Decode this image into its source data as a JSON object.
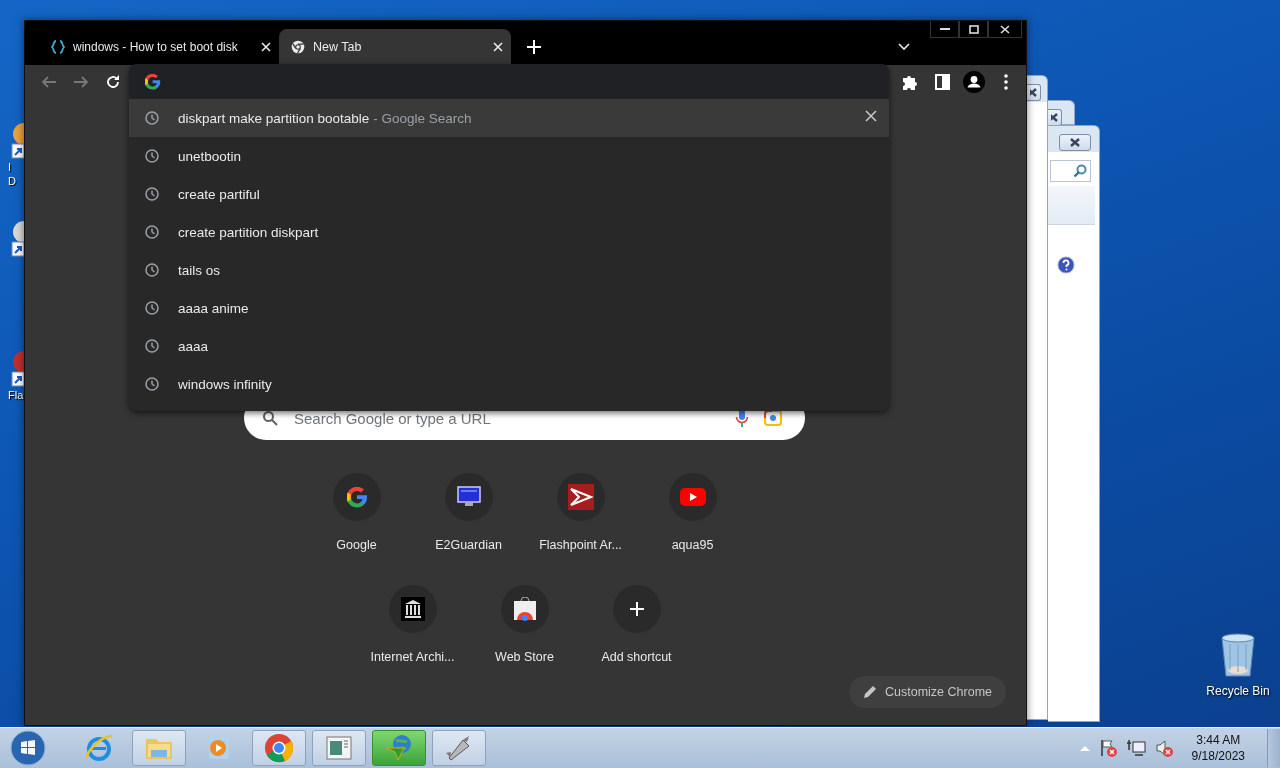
{
  "desktop": {
    "icons": [
      {
        "kind": "wheel",
        "lines": [
          "I",
          "D"
        ]
      },
      {
        "kind": "disc"
      },
      {
        "kind": "red",
        "lines": [
          "Fla"
        ]
      }
    ],
    "recycle_bin": "Recycle Bin"
  },
  "background_windows": [
    {
      "kind": "plain"
    },
    {
      "kind": "plain"
    },
    {
      "kind": "search"
    }
  ],
  "browser": {
    "tabs": [
      {
        "title": "windows - How to set boot disk",
        "kind": "code",
        "selected": false
      },
      {
        "title": "New Tab",
        "kind": "chrome",
        "selected": true
      }
    ],
    "suggestions": [
      {
        "text": "diskpart make partition bootable",
        "suffix": "- Google Search",
        "selected": true
      },
      {
        "text": "unetbootin",
        "selected": false
      },
      {
        "text": "create partiful",
        "selected": false
      },
      {
        "text": "create partition diskpart",
        "selected": false
      },
      {
        "text": "tails os",
        "selected": false
      },
      {
        "text": "aaaa anime",
        "selected": false
      },
      {
        "text": "aaaa",
        "selected": false
      },
      {
        "text": "windows infinity",
        "selected": false
      }
    ],
    "search": {
      "placeholder": "Search Google or type a URL"
    },
    "shortcuts": [
      {
        "label": "Google",
        "kind": "google"
      },
      {
        "label": "E2Guardian",
        "kind": "monitor"
      },
      {
        "label": "Flashpoint Ar...",
        "kind": "flashpoint"
      },
      {
        "label": "aqua95",
        "kind": "youtube"
      },
      {
        "label": "Internet Archi...",
        "kind": "archive"
      },
      {
        "label": "Web Store",
        "kind": "store"
      },
      {
        "label": "Add shortcut",
        "kind": "add"
      }
    ],
    "customize_button": "Customize Chrome"
  },
  "taskbar": {
    "apps": [
      {
        "kind": "ie",
        "running": false
      },
      {
        "kind": "folder",
        "running": true
      },
      {
        "kind": "media",
        "running": false
      },
      {
        "kind": "chrome",
        "running": true
      },
      {
        "kind": "document",
        "running": true
      },
      {
        "kind": "download",
        "running": true
      },
      {
        "kind": "rocket",
        "running": true
      }
    ],
    "clock": {
      "time": "3:44 AM",
      "date": "9/18/2023"
    }
  }
}
